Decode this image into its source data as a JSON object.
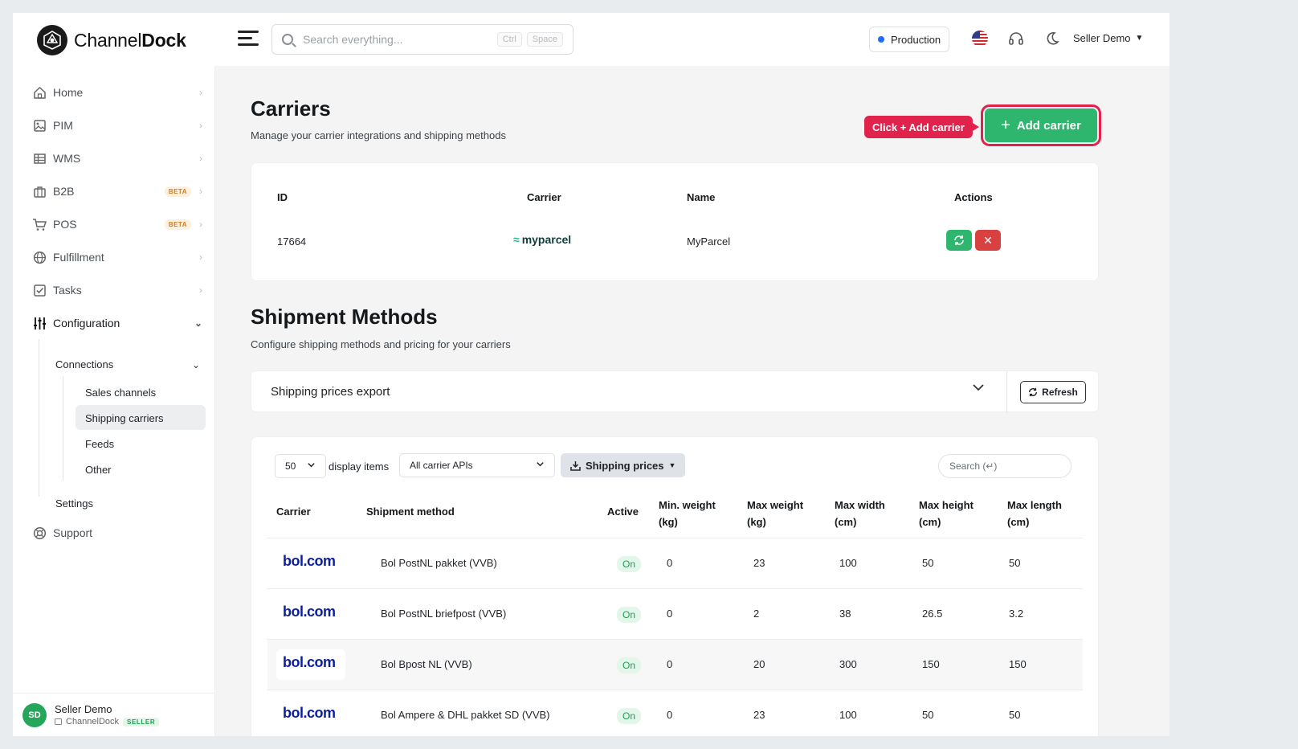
{
  "header": {
    "brand_light": "Channel",
    "brand_bold": "Dock",
    "search_placeholder": "Search everything...",
    "search_kbd_1": "Ctrl",
    "search_kbd_2": "Space",
    "environment": "Production",
    "user": "Seller Demo"
  },
  "sidebar": {
    "items": [
      {
        "label": "Home",
        "icon": "home-icon"
      },
      {
        "label": "PIM",
        "icon": "image-icon"
      },
      {
        "label": "WMS",
        "icon": "table-icon"
      },
      {
        "label": "B2B",
        "icon": "briefcase-icon",
        "badge": "BETA"
      },
      {
        "label": "POS",
        "icon": "cart-icon",
        "badge": "BETA"
      },
      {
        "label": "Fulfillment",
        "icon": "globe-icon"
      },
      {
        "label": "Tasks",
        "icon": "check-square-icon"
      },
      {
        "label": "Configuration",
        "icon": "sliders-icon"
      }
    ],
    "connections_label": "Connections",
    "sub_items": [
      "Sales channels",
      "Shipping carriers",
      "Feeds",
      "Other"
    ],
    "settings_label": "Settings",
    "support_label": "Support",
    "footer": {
      "initials": "SD",
      "name": "Seller Demo",
      "org": "ChannelDock",
      "role": "SELLER"
    }
  },
  "carriers": {
    "title": "Carriers",
    "subtitle": "Manage your carrier integrations and shipping methods",
    "hint": "Click + Add carrier",
    "add_button": "Add carrier",
    "columns": [
      "ID",
      "Carrier",
      "Name",
      "Actions"
    ],
    "rows": [
      {
        "id": "17664",
        "carrier_logo": "myparcel",
        "name": "MyParcel"
      }
    ]
  },
  "shipment_methods": {
    "title": "Shipment Methods",
    "subtitle": "Configure shipping methods and pricing for your carriers",
    "export_label": "Shipping prices export",
    "refresh_label": "Refresh",
    "page_size": "50",
    "display_items_label": "display items",
    "carrier_api_filter": "All carrier APIs",
    "shipping_prices_label": "Shipping prices",
    "search_placeholder": "Search (↵)",
    "columns": {
      "carrier": "Carrier",
      "method": "Shipment method",
      "active": "Active",
      "min_weight_1": "Min. weight",
      "min_weight_2": "(kg)",
      "max_weight_1": "Max weight",
      "max_weight_2": "(kg)",
      "max_width_1": "Max width",
      "max_width_2": "(cm)",
      "max_height_1": "Max height",
      "max_height_2": "(cm)",
      "max_length_1": "Max length",
      "max_length_2": "(cm)"
    },
    "rows": [
      {
        "carrier": "bol.com",
        "method": "Bol PostNL pakket (VVB)",
        "active": "On",
        "min_w": "0",
        "max_w": "23",
        "width": "100",
        "height": "50",
        "length": "50"
      },
      {
        "carrier": "bol.com",
        "method": "Bol PostNL briefpost (VVB)",
        "active": "On",
        "min_w": "0",
        "max_w": "2",
        "width": "38",
        "height": "26.5",
        "length": "3.2"
      },
      {
        "carrier": "bol.com",
        "method": "Bol Bpost NL (VVB)",
        "active": "On",
        "min_w": "0",
        "max_w": "20",
        "width": "300",
        "height": "150",
        "length": "150"
      },
      {
        "carrier": "bol.com",
        "method": "Bol Ampere & DHL pakket SD (VVB)",
        "active": "On",
        "min_w": "0",
        "max_w": "23",
        "width": "100",
        "height": "50",
        "length": "50"
      }
    ]
  },
  "colors": {
    "accent_green": "#2fb66e",
    "danger_red": "#d94040",
    "hint_red": "#e0224d",
    "bol_blue": "#0b1f9b"
  }
}
